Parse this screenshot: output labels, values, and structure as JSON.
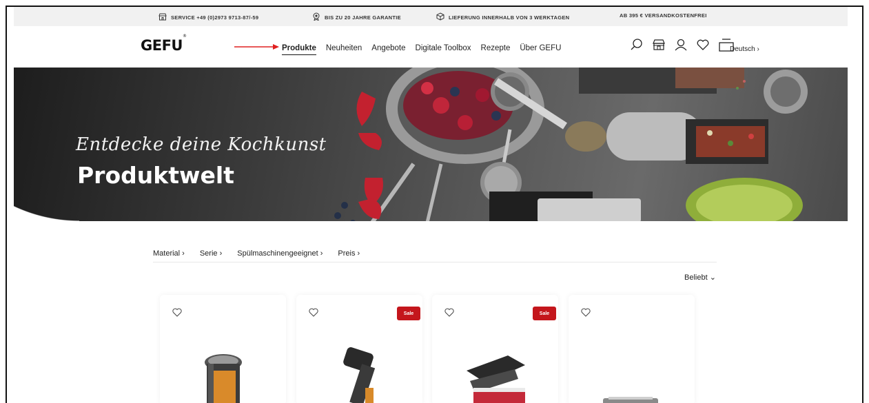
{
  "topbar": {
    "service": "SERVICE +49 (0)2973 9713-87/-59",
    "warranty": "BIS ZU 20 JAHRE GARANTIE",
    "delivery": "LIEFERUNG INNERHALB VON 3 WERKTAGEN",
    "shipping": "AB 395 € VERSANDKOSTENFREI"
  },
  "header": {
    "logo": "GEFU",
    "logo_mark": "®",
    "menu": [
      "Produkte",
      "Neuheiten",
      "Angebote",
      "Digitale Toolbox",
      "Rezepte",
      "Über GEFU"
    ],
    "active_menu": "Produkte",
    "language": "Deutsch ›"
  },
  "hero": {
    "script": "Entdecke deine Kochkunst",
    "title": "Produktwelt"
  },
  "filters": {
    "items": [
      "Material ›",
      "Serie ›",
      "Spülmaschinengeeignet ›",
      "Preis ›"
    ],
    "sort": "Beliebt ⌄"
  },
  "products": [
    {
      "sale": ""
    },
    {
      "sale": "Sale"
    },
    {
      "sale": "Sale"
    },
    {
      "sale": ""
    }
  ],
  "colors": {
    "accent": "#c4161c",
    "arrow": "#e02020"
  }
}
